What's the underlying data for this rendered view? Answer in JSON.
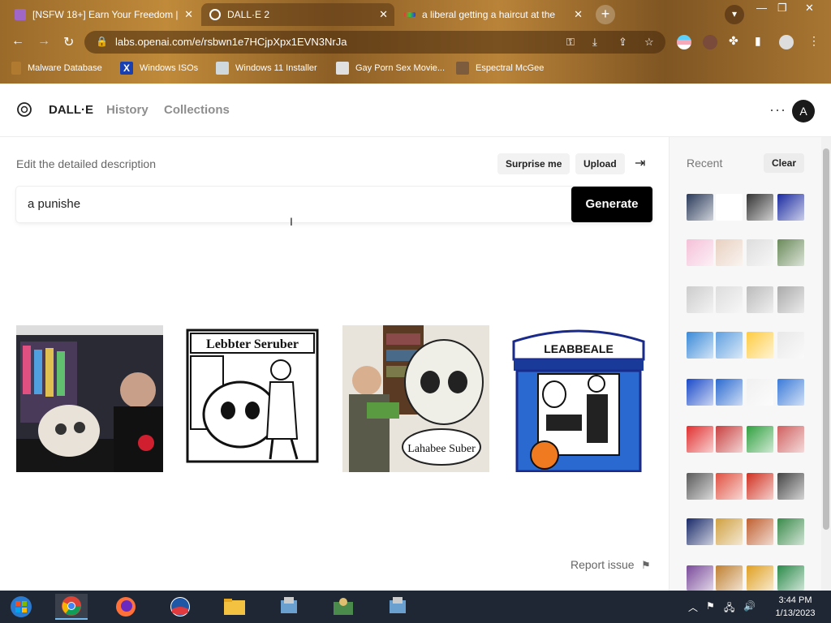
{
  "browser": {
    "tabs": [
      {
        "title": "[NSFW 18+] Earn Your Freedom |",
        "active": false
      },
      {
        "title": "DALL·E 2",
        "active": true
      },
      {
        "title": "a liberal getting a haircut at the",
        "active": false
      }
    ],
    "url": "labs.openai.com/e/rsbwn1e7HCjpXpx1EVN3NrJa",
    "bookmarks": [
      {
        "label": "Malware Database",
        "icon": "malware-icon"
      },
      {
        "label": "Windows ISOs",
        "icon": "x-icon"
      },
      {
        "label": "Windows 11 Installer",
        "icon": "image-icon"
      },
      {
        "label": "Gay Porn Sex Movie...",
        "icon": "cube-icon"
      },
      {
        "label": "Espectral McGee",
        "icon": "mask-icon"
      }
    ]
  },
  "header": {
    "brand": "DALL·E",
    "nav": [
      "History",
      "Collections"
    ],
    "more": "···",
    "avatar": "A"
  },
  "editor": {
    "label": "Edit the detailed description",
    "surprise": "Surprise me",
    "upload": "Upload",
    "prompt": "a punishe",
    "generate": "Generate"
  },
  "results": [
    {
      "alt": "barber shaving skull",
      "caption": ""
    },
    {
      "alt": "cartoon skull barber",
      "caption": "Lebbter Seruber"
    },
    {
      "alt": "man holding money with skull",
      "caption": "Lahabee Suber"
    },
    {
      "alt": "blue barbershop with skull",
      "caption": "LEABBEALE"
    }
  ],
  "footer": {
    "report": "Report issue"
  },
  "sidebar": {
    "title": "Recent",
    "clear": "Clear"
  },
  "taskbar": {
    "time": "3:44 PM",
    "date": "1/13/2023"
  }
}
